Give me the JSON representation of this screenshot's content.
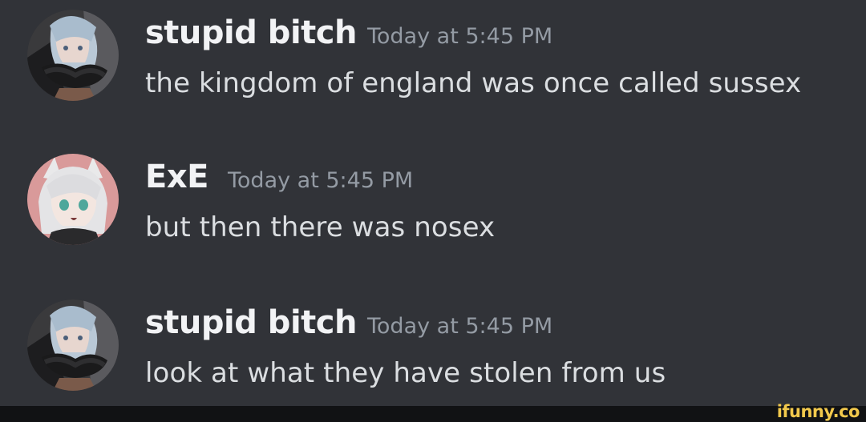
{
  "messages": [
    {
      "username": "stupid bitch",
      "timestamp": "Today at 5:45 PM",
      "text": "the kingdom of england was once called sussex",
      "avatar_icon": "anime-character-dark-avatar-icon"
    },
    {
      "username": "ExE",
      "timestamp": "Today at 5:45 PM",
      "text": "but then there was nosex",
      "avatar_icon": "anime-character-white-hair-avatar-icon"
    },
    {
      "username": "stupid bitch",
      "timestamp": "Today at 5:45 PM",
      "text": "look at what they have stolen from us",
      "avatar_icon": "anime-character-dark-avatar-icon"
    }
  ],
  "watermark": "ifunny.co",
  "colors": {
    "background": "#313338",
    "username": "#f2f3f5",
    "timestamp": "#949ba4",
    "message_text": "#dbdee1",
    "watermark": "#f2c94c"
  }
}
